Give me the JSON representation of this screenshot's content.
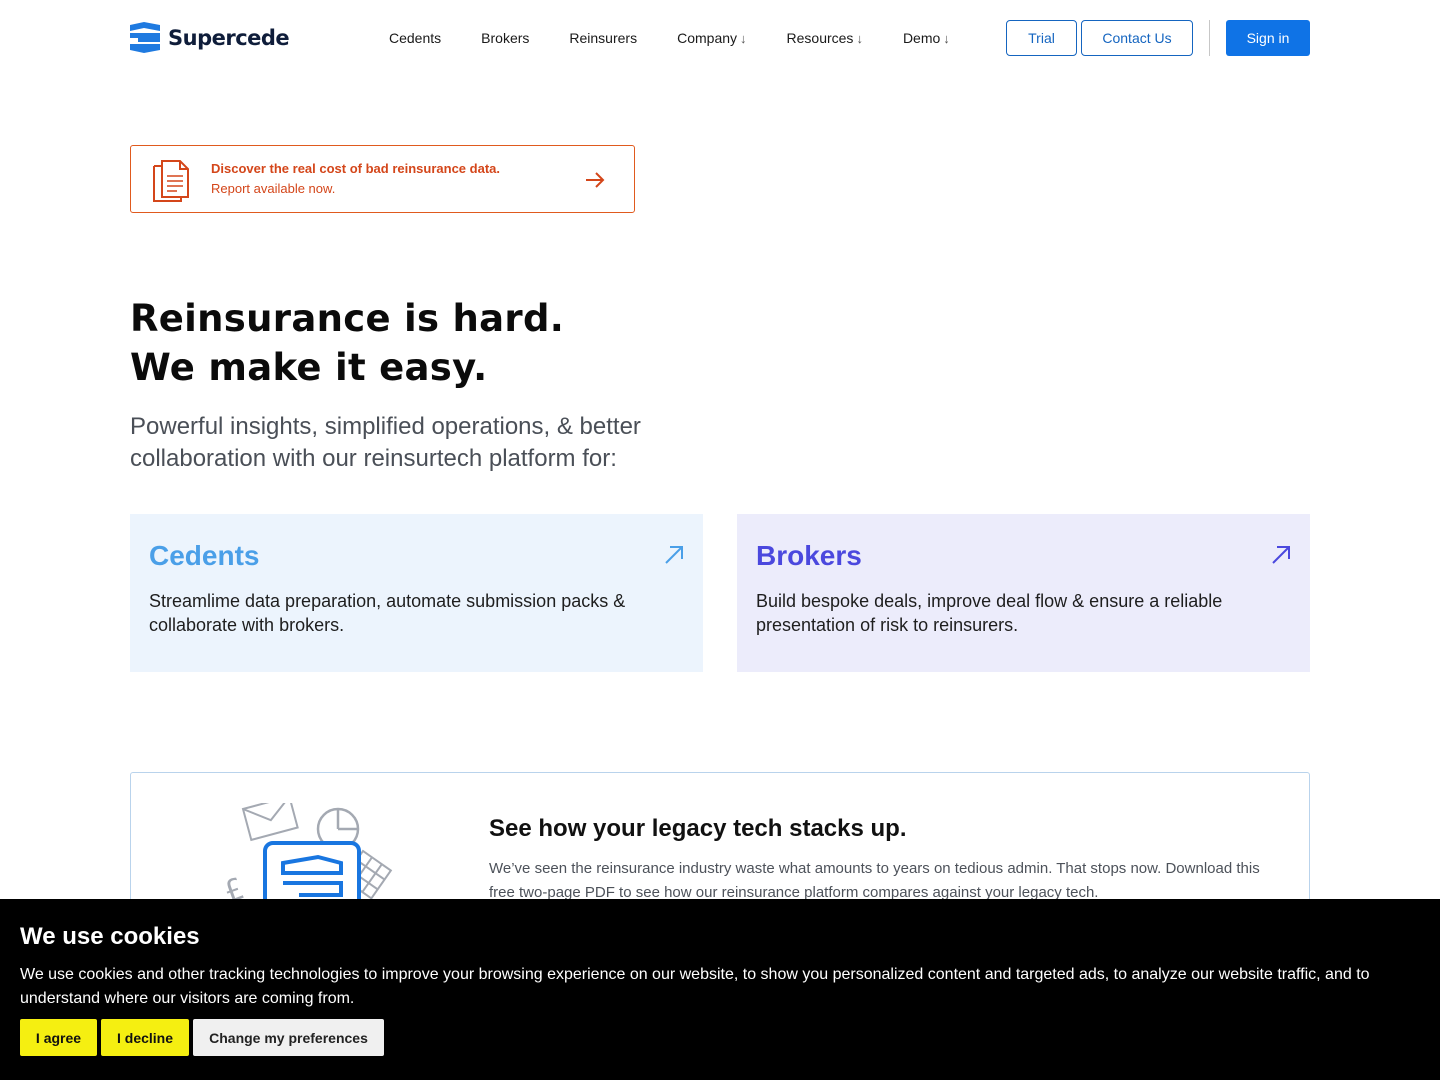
{
  "header": {
    "logo_text": "Supercede",
    "nav": [
      {
        "label": "Cedents",
        "has_dropdown": false
      },
      {
        "label": "Brokers",
        "has_dropdown": false
      },
      {
        "label": "Reinsurers",
        "has_dropdown": false
      },
      {
        "label": "Company",
        "has_dropdown": true
      },
      {
        "label": "Resources",
        "has_dropdown": true
      },
      {
        "label": "Demo",
        "has_dropdown": true
      }
    ],
    "dropdown_arrow": "↓",
    "trial_label": "Trial",
    "contact_label": "Contact Us",
    "signin_label": "Sign in"
  },
  "banner": {
    "line1": "Discover the real cost of bad reinsurance data.",
    "line2": "Report available now.",
    "icon": "document-icon",
    "arrow": "arrow-right-icon"
  },
  "hero": {
    "title_line1": "Reinsurance is hard.",
    "title_line2": "We make it easy.",
    "subtitle": "Powerful insights, simplified operations, & better collaboration with our reinsurtech platform for:"
  },
  "cards": [
    {
      "title": "Cedents",
      "description": "Streamlime data preparation, automate submission packs & collaborate with brokers.",
      "color": "#4a9fe8",
      "bg": "#ecf4fd"
    },
    {
      "title": "Brokers",
      "description": "Build bespoke deals, improve deal flow & ensure a reliable presentation of risk to reinsurers.",
      "color": "#4b48de",
      "bg": "#ececfb"
    }
  ],
  "legacy": {
    "title": "See how your legacy tech stacks up.",
    "description": "We’ve seen the reinsurance industry waste what amounts to years on tedious admin. That stops now. Download this free two-page PDF to see how our reinsurance platform compares against your legacy tech."
  },
  "cookie": {
    "title": "We use cookies",
    "text": "We use cookies and other tracking technologies to improve your browsing experience on our website, to show you personalized content and targeted ads, to analyze our website traffic, and to understand where our visitors are coming from.",
    "agree_label": "I agree",
    "decline_label": "I decline",
    "prefs_label": "Change my preferences"
  },
  "colors": {
    "primary": "#0f73e6",
    "accent_orange": "#d4461a",
    "cookie_button": "#f5ef11"
  }
}
